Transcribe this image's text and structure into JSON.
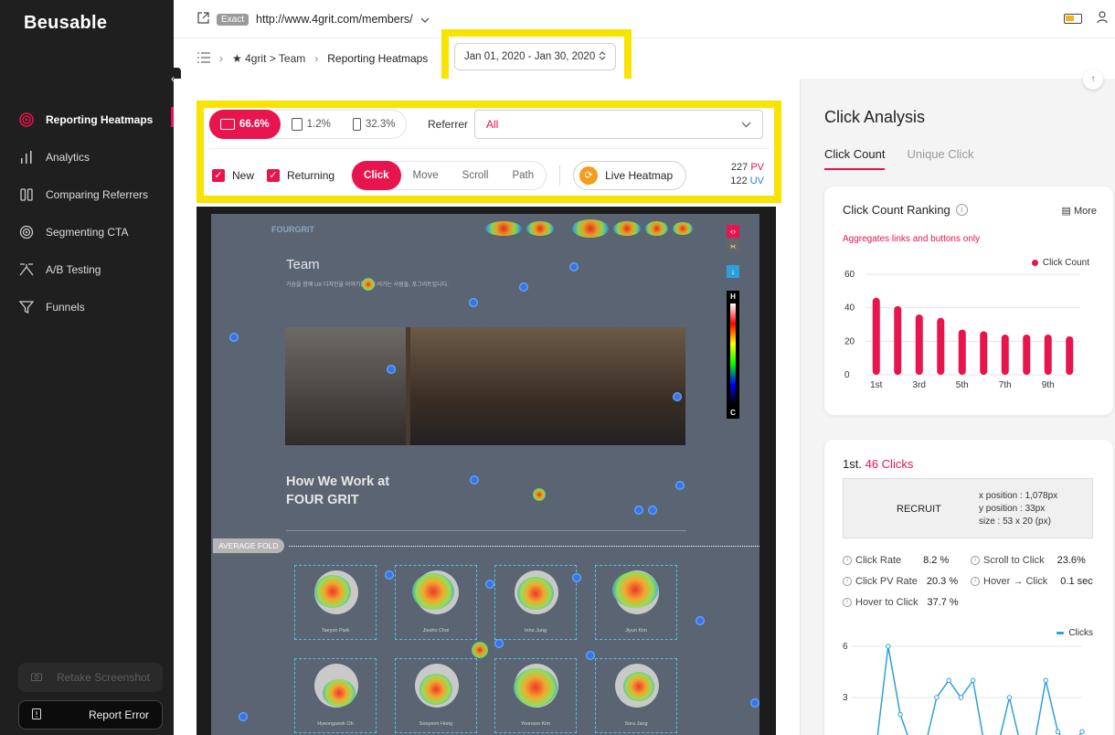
{
  "sidebar": {
    "logo": "Beusable",
    "items": [
      {
        "label": "Reporting Heatmaps",
        "icon": "target-icon",
        "active": true
      },
      {
        "label": "Analytics",
        "icon": "bar-chart-icon",
        "active": false
      },
      {
        "label": "Comparing Referrers",
        "icon": "columns-icon",
        "active": false
      },
      {
        "label": "Segmenting CTA",
        "icon": "broadcast-icon",
        "active": false
      },
      {
        "label": "A/B Testing",
        "icon": "ab-test-icon",
        "active": false
      },
      {
        "label": "Funnels",
        "icon": "funnel-icon",
        "active": false
      }
    ],
    "retake_label": "Retake Screenshot",
    "report_label": "Report Error"
  },
  "topbar": {
    "exact_badge": "Exact",
    "url": "http://www.4grit.com/members/"
  },
  "breadcrumb": {
    "root": "★ 4grit > Team",
    "current": "Reporting Heatmaps",
    "date_range": "Jan 01, 2020 - Jan 30, 2020"
  },
  "controls": {
    "devices": [
      {
        "label": "66.6%",
        "icon": "desktop-icon",
        "active": true
      },
      {
        "label": "1.2%",
        "icon": "tablet-icon",
        "active": false
      },
      {
        "label": "32.3%",
        "icon": "mobile-icon",
        "active": false
      }
    ],
    "referrer_label": "Referrer",
    "referrer_value": "All",
    "new_label": "New",
    "returning_label": "Returning",
    "modes": [
      {
        "label": "Click",
        "active": true
      },
      {
        "label": "Move",
        "active": false
      },
      {
        "label": "Scroll",
        "active": false
      },
      {
        "label": "Path",
        "active": false
      }
    ],
    "live_label": "Live Heatmap",
    "pv_value": "227",
    "pv_unit": "PV",
    "uv_value": "122",
    "uv_unit": "UV"
  },
  "heatmap_page": {
    "brand": "FOURGRIT",
    "title": "Team",
    "desc": "가슴을 함께 UX 디자인을 이야기를 나누어가는 사람들, 포그리트입니다.",
    "heading_line1": "How We Work at",
    "heading_line2": "FOUR GRIT",
    "fold_label": "AVERAGE FOLD",
    "people_row1": [
      "Taeyon Park",
      "Jisoho Choi",
      "Inho Jung",
      "Jiyun Kim"
    ],
    "people_row2": [
      "Hyeongseok Oh",
      "Sooyeon Hong",
      "Yeonsoo Kim",
      "Sora Jang"
    ],
    "scale_high": "H",
    "scale_low": "C"
  },
  "right_panel": {
    "title": "Click Analysis",
    "tabs": [
      {
        "label": "Click Count",
        "active": true
      },
      {
        "label": "Unique Click",
        "active": false
      }
    ],
    "ranking_title": "Click Count Ranking",
    "more_label": "More",
    "ranking_note": "Aggregates links and buttons only",
    "ranking_legend": "Click Count",
    "detail_rank": "1st.",
    "detail_clicks": "46 Clicks",
    "element_name": "RECRUIT",
    "x_position": "x position : 1,078px",
    "y_position": "y position : 33px",
    "size": "size : 53 x 20 (px)",
    "stats": [
      {
        "label": "Click Rate",
        "value": "8.2 %"
      },
      {
        "label": "Scroll to Click",
        "value": "23.6%"
      },
      {
        "label": "Click PV Rate",
        "value": "20.3 %"
      },
      {
        "label": "Hover → Click",
        "value": "0.1 sec"
      },
      {
        "label": "Hover to Click",
        "value": "37.7 %"
      }
    ],
    "line_legend": "Clicks"
  },
  "chart_data": [
    {
      "type": "bar",
      "title": "Click Count Ranking",
      "categories": [
        "1st",
        "2nd",
        "3rd",
        "4th",
        "5th",
        "6th",
        "7th",
        "8th",
        "9th",
        "10th"
      ],
      "x_tick_labels": [
        "1st",
        "3rd",
        "5th",
        "7th",
        "9th"
      ],
      "series": [
        {
          "name": "Click Count",
          "values": [
            46,
            41,
            36,
            34,
            27,
            26,
            24,
            24,
            24,
            23
          ]
        }
      ],
      "ylim": [
        0,
        60
      ],
      "yticks": [
        0,
        20,
        40,
        60
      ],
      "grid": true,
      "legend": "top-right",
      "color": "#e7144e"
    },
    {
      "type": "line",
      "series": [
        {
          "name": "Clicks",
          "values": [
            0,
            0,
            0,
            6,
            2,
            0,
            0,
            3,
            4,
            3,
            4,
            0,
            0,
            3,
            0,
            0,
            4,
            1,
            0,
            1
          ]
        }
      ],
      "ylim": [
        0,
        6
      ],
      "yticks": [
        3,
        6
      ],
      "grid": true,
      "legend": "top-right",
      "color": "#2e9fdc"
    }
  ]
}
